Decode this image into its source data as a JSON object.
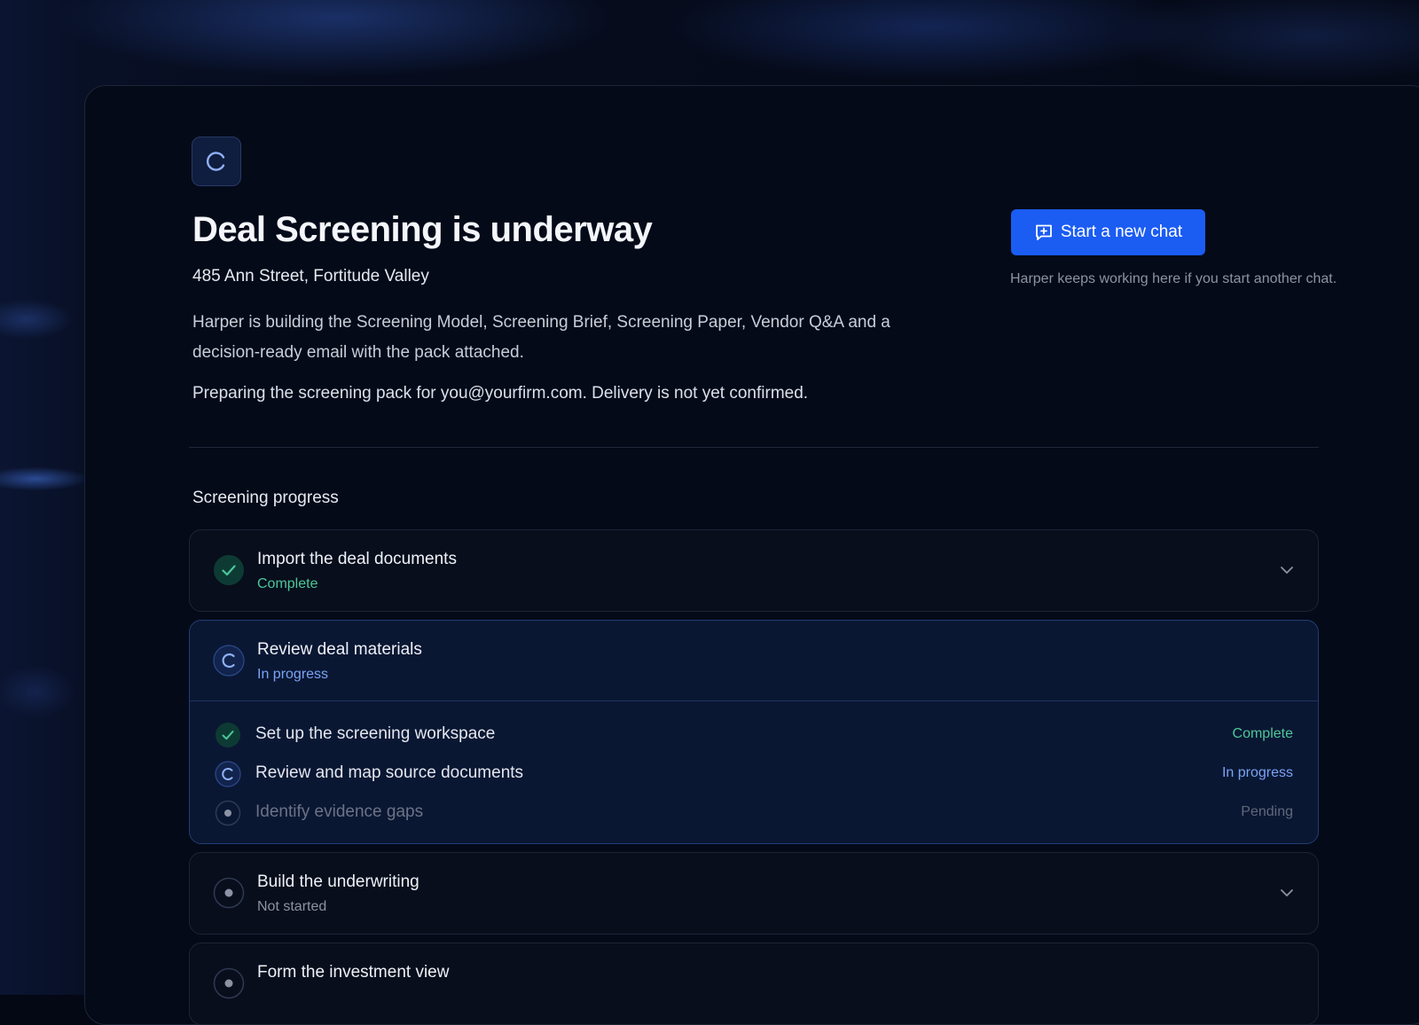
{
  "header": {
    "title": "Deal Screening is underway",
    "address": "485 Ann Street, Fortitude Valley",
    "description": "Harper is building the Screening Model, Screening Brief, Screening Paper, Vendor Q&A and a decision-ready email with the pack attached.",
    "delivery_note": "Preparing the screening pack for you@yourfirm.com. Delivery is not yet confirmed.",
    "status_icon": "loading-spinner-icon"
  },
  "actions": {
    "new_chat_label": "Start a new chat",
    "new_chat_icon": "chat-plus-icon",
    "new_chat_note": "Harper keeps working here if you start another chat."
  },
  "progress": {
    "section_title": "Screening progress",
    "steps": [
      {
        "title": "Import the deal documents",
        "status": "Complete",
        "state": "complete",
        "expanded": false
      },
      {
        "title": "Review deal materials",
        "status": "In progress",
        "state": "in-progress",
        "expanded": true,
        "substeps": [
          {
            "label": "Set up the screening workspace",
            "status": "Complete",
            "state": "complete"
          },
          {
            "label": "Review and map source documents",
            "status": "In progress",
            "state": "in-progress"
          },
          {
            "label": "Identify evidence gaps",
            "status": "Pending",
            "state": "pending"
          }
        ]
      },
      {
        "title": "Build the underwriting",
        "status": "Not started",
        "state": "not-started",
        "expanded": false
      },
      {
        "title": "Form the investment view",
        "status": "",
        "state": "not-started",
        "expanded": false
      }
    ]
  },
  "colors": {
    "accent": "#1b5cf2",
    "complete": "#4cc79a",
    "in_progress": "#7aa3f4",
    "background": "#040a18"
  }
}
